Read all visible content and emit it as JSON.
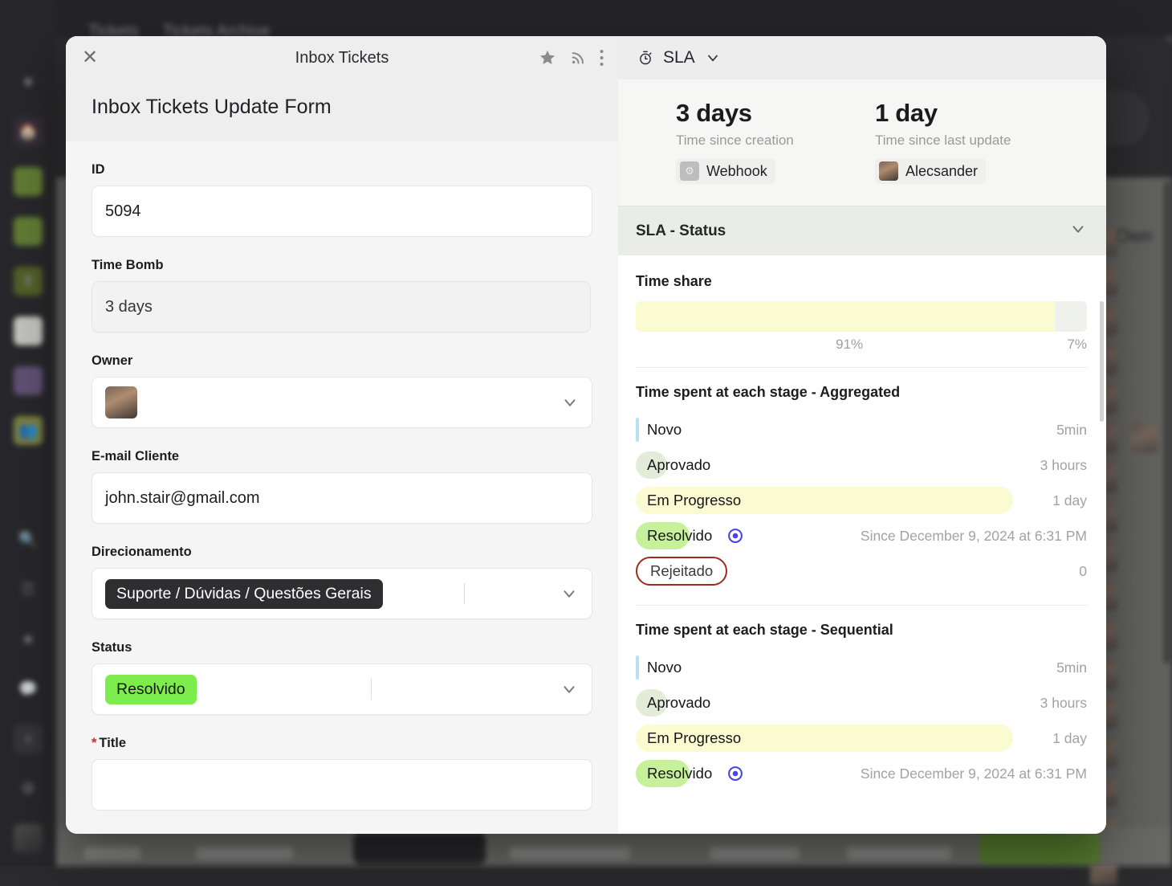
{
  "background": {
    "tabs": [
      "Tickets",
      "Tickets Archive"
    ],
    "own_column_header": "Own",
    "sidebar_icons": [
      "hamburger-menu-icon",
      "star-icon",
      "home-icon",
      "brazil-flag-icon",
      "usa-flag-icon",
      "upload-arrow-icon",
      "document-icon",
      "wrench-icon",
      "users-icon",
      "search-icon",
      "grid-apps-icon",
      "star-outline-icon",
      "comment-icon",
      "notification-count-icon",
      "gear-icon",
      "profile-photo-icon"
    ],
    "notification_count": "0"
  },
  "modal": {
    "title": "Inbox Tickets",
    "close_icon": "close-icon",
    "header_icons": [
      "star-icon",
      "rss-signal-icon",
      "more-vertical-icon"
    ],
    "form_title": "Inbox Tickets Update Form",
    "fields": [
      {
        "label": "ID",
        "value": "5094",
        "type": "text",
        "required": false
      },
      {
        "label": "Time Bomb",
        "value": "3 days",
        "type": "readonly",
        "required": false
      },
      {
        "label": "Owner",
        "value": "",
        "type": "avatar-select",
        "required": false
      },
      {
        "label": "E-mail Cliente",
        "value": "john.stair@gmail.com",
        "type": "text",
        "required": false
      },
      {
        "label": "Direcionamento",
        "value": "Suporte / Dúvidas / Questões Gerais",
        "type": "tag-select-dark",
        "required": false
      },
      {
        "label": "Status",
        "value": "Resolvido",
        "type": "tag-select-green",
        "required": false
      },
      {
        "label": "Title",
        "value": "",
        "type": "text",
        "required": true
      }
    ]
  },
  "sla": {
    "panel_title": "SLA",
    "panel_icon": "stopwatch-icon",
    "panel_caret": "chevron-down-icon",
    "summary": [
      {
        "value": "3 days",
        "label": "Time since creation",
        "chip_name": "Webhook",
        "chip_icon": "webhook-icon"
      },
      {
        "value": "1 day",
        "label": "Time since last update",
        "chip_name": "Alecsander",
        "chip_icon": "avatar-icon"
      }
    ],
    "status_section_title": "SLA - Status",
    "status_section_caret": "chevron-down-icon",
    "time_share": {
      "title": "Time share",
      "segments": [
        {
          "percent_label": "91%",
          "percent": 91,
          "color": "#fbfbd2"
        },
        {
          "percent_label": "7%",
          "percent": 7,
          "color": "#eef1ec"
        }
      ]
    },
    "aggregated": {
      "title": "Time spent at each stage - Aggregated",
      "rows": [
        {
          "stage": "Novo",
          "value": "5min",
          "style": "bar-blue",
          "width_pct": 0,
          "marker": null
        },
        {
          "stage": "Aprovado",
          "value": "3 hours",
          "style": "pill-paleGreen",
          "width_pct": 7,
          "marker": null
        },
        {
          "stage": "Em Progresso",
          "value": "1 day",
          "style": "pill-yellow",
          "width_pct": 84,
          "marker": null
        },
        {
          "stage": "Resolvido",
          "value": "Since December 9, 2024 at 6:31 PM",
          "style": "pill-green",
          "width_pct": 12,
          "marker": "target-icon"
        },
        {
          "stage": "Rejeitado",
          "value": "0",
          "style": "outline-red",
          "width_pct": 0,
          "marker": null
        }
      ]
    },
    "sequential": {
      "title": "Time spent at each stage - Sequential",
      "rows": [
        {
          "stage": "Novo",
          "value": "5min",
          "style": "bar-blue",
          "width_pct": 0,
          "marker": null
        },
        {
          "stage": "Aprovado",
          "value": "3 hours",
          "style": "pill-paleGreen",
          "width_pct": 7,
          "marker": null
        },
        {
          "stage": "Em Progresso",
          "value": "1 day",
          "style": "pill-yellow",
          "width_pct": 84,
          "marker": null
        },
        {
          "stage": "Resolvido",
          "value": "Since December 9, 2024 at 6:31 PM",
          "style": "pill-green",
          "width_pct": 12,
          "marker": "target-icon"
        }
      ]
    }
  },
  "colors": {
    "yellow_pill": "#fbfbd2",
    "green_pill": "#c6f09a",
    "pale_green_pill": "#e2ecd8",
    "blue_bar": "#b9dff5",
    "red_outline": "#9d2b20",
    "target_blue": "#4a45e0",
    "status_tag_green": "#7ded4e",
    "tag_dark": "#2e2e31"
  }
}
